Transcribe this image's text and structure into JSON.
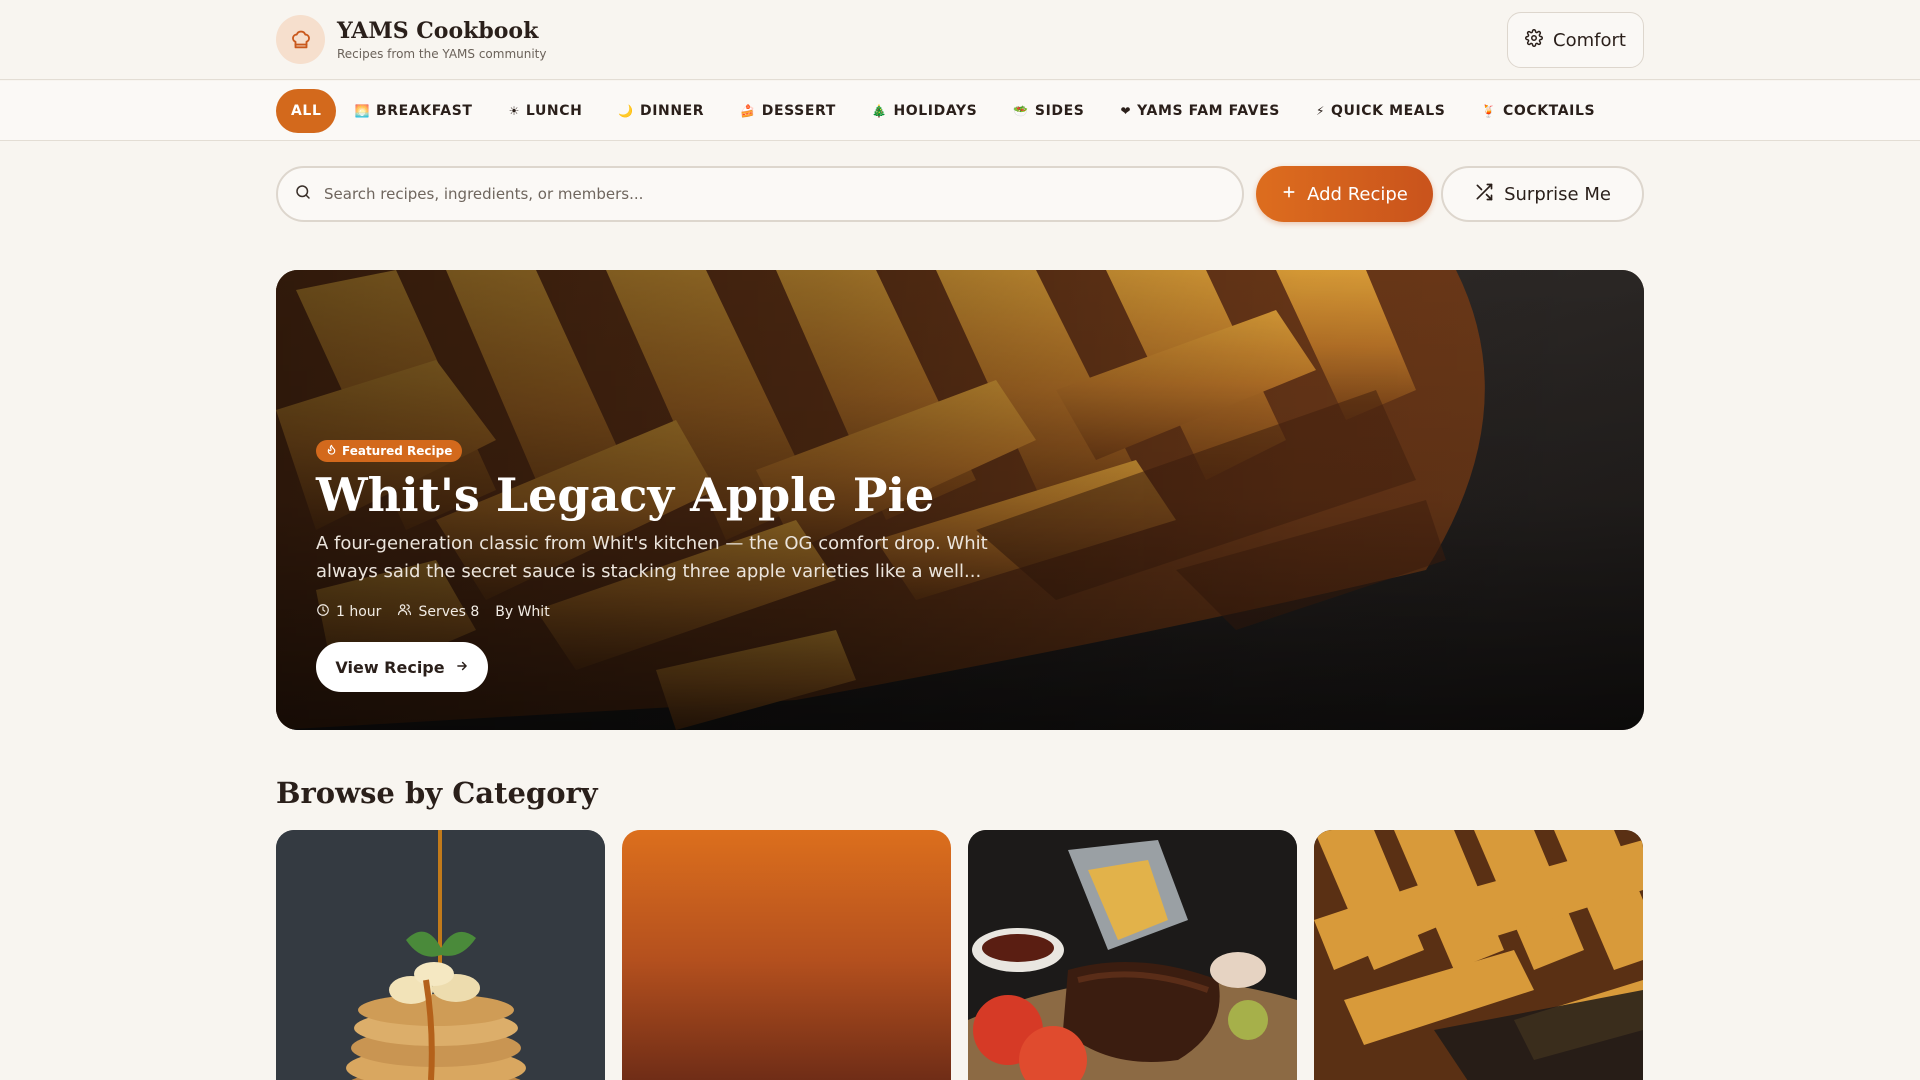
{
  "header": {
    "title": "YAMS Cookbook",
    "subtitle": "Recipes from the YAMS community",
    "theme_label": "Comfort"
  },
  "nav": {
    "categories": [
      {
        "label": "ALL",
        "emoji": ""
      },
      {
        "label": "BREAKFAST",
        "emoji": "🌅"
      },
      {
        "label": "LUNCH",
        "emoji": "☀"
      },
      {
        "label": "DINNER",
        "emoji": "🌙"
      },
      {
        "label": "DESSERT",
        "emoji": "🍰"
      },
      {
        "label": "HOLIDAYS",
        "emoji": "🎄"
      },
      {
        "label": "SIDES",
        "emoji": "🥗"
      },
      {
        "label": "YAMS FAM FAVES",
        "emoji": "❤"
      },
      {
        "label": "QUICK MEALS",
        "emoji": "⚡"
      },
      {
        "label": "COCKTAILS",
        "emoji": "🍹"
      }
    ],
    "active_index": 0
  },
  "search": {
    "placeholder": "Search recipes, ingredients, or members..."
  },
  "actions": {
    "add_label": "Add Recipe",
    "surprise_label": "Surprise Me"
  },
  "hero": {
    "badge": "Featured Recipe",
    "title": "Whit's Legacy Apple Pie",
    "description": "A four-generation classic from Whit's kitchen — the OG comfort drop. Whit always said the secret sauce is stacking three apple varieties like a well...",
    "time": "1 hour",
    "serves": "Serves 8",
    "author": "By Whit",
    "cta": "View Recipe"
  },
  "browse": {
    "title": "Browse by Category"
  },
  "colors": {
    "accent": "#d3691c",
    "background": "#f8f5f0",
    "text": "#2a1f1a"
  },
  "icons": {
    "logo": "chef-hat-icon",
    "theme": "gear-icon",
    "search": "search-icon",
    "add": "plus-icon",
    "surprise": "shuffle-icon",
    "badge": "flame-icon",
    "time": "clock-icon",
    "serves": "users-icon",
    "cta": "arrow-right-icon"
  }
}
